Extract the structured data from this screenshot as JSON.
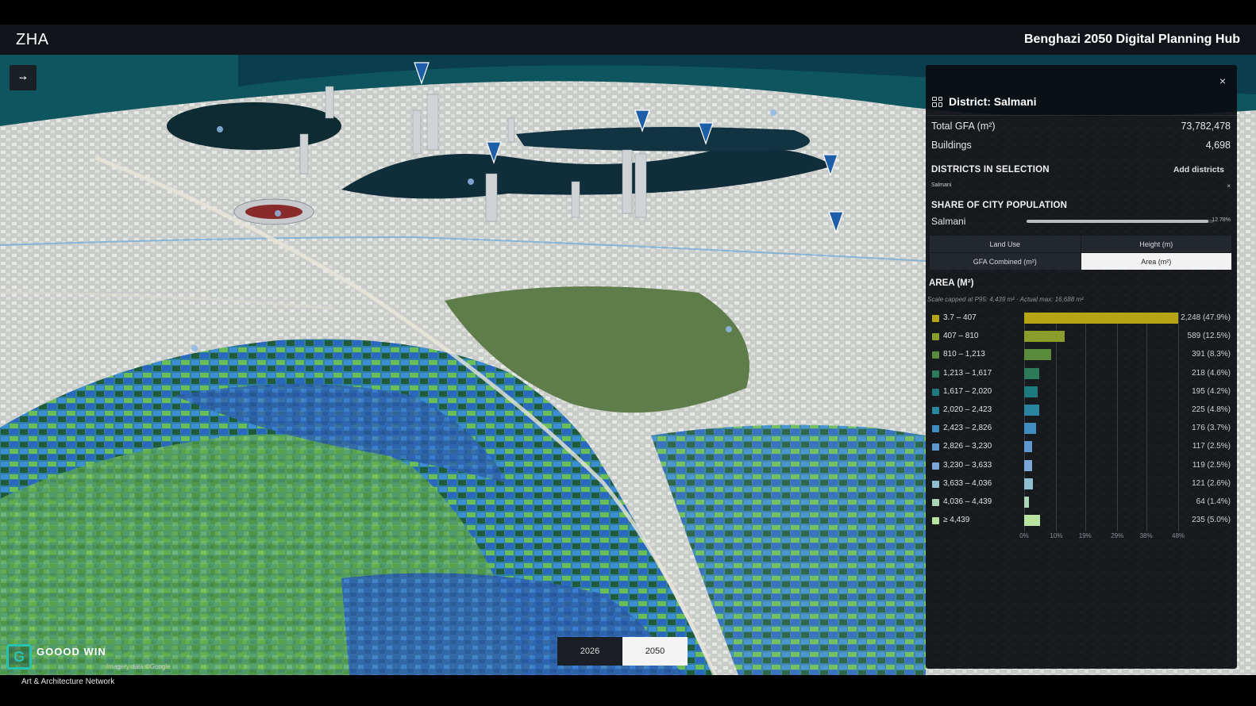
{
  "header": {
    "logo": "ZHA",
    "title": "Benghazi 2050 Digital Planning Hub"
  },
  "map": {
    "nav_icon": "compass-arrow-icon"
  },
  "panel": {
    "title": "District: Salmani",
    "close_label": "×",
    "total_gfa_label": "Total GFA (m²)",
    "total_gfa_value": "73,782,478",
    "buildings_label": "Buildings",
    "buildings_value": "4,698",
    "districts_title": "DISTRICTS IN SELECTION",
    "add_districts_label": "Add districts",
    "selected_district": "Salmani",
    "remove_label": "×",
    "population_title": "SHARE OF CITY POPULATION",
    "population_label": "Salmani",
    "population_share": 12.78,
    "population_value": "12.78%",
    "tabs": [
      {
        "label": "Land Use",
        "active": false
      },
      {
        "label": "Height (m)",
        "active": false
      },
      {
        "label": "GFA Combined (m²)",
        "active": false
      },
      {
        "label": "Area (m²)",
        "active": true
      }
    ],
    "area_title": "AREA (M²)",
    "area_note": "Scale capped at P95: 4,439 m² · Actual max: 16,688 m²"
  },
  "chart_data": {
    "type": "bar",
    "orientation": "horizontal",
    "title": "AREA (M²)",
    "categories": [
      "3.7 – 407",
      "407 – 810",
      "810 – 1,213",
      "1,213 – 1,617",
      "1,617 – 2,020",
      "2,020 – 2,423",
      "2,423 – 2,826",
      "2,826 – 3,230",
      "3,230 – 3,633",
      "3,633 – 4,036",
      "4,036 – 4,439",
      "≥ 4,439"
    ],
    "values": [
      2248,
      589,
      391,
      218,
      195,
      225,
      176,
      117,
      119,
      121,
      64,
      235
    ],
    "percents": [
      47.9,
      12.5,
      8.3,
      4.6,
      4.2,
      4.8,
      3.7,
      2.5,
      2.5,
      2.6,
      1.4,
      5.0
    ],
    "value_labels": [
      "2,248 (47.9%)",
      "589 (12.5%)",
      "391 (8.3%)",
      "218 (4.6%)",
      "195 (4.2%)",
      "225 (4.8%)",
      "176 (3.7%)",
      "117 (2.5%)",
      "119 (2.5%)",
      "121 (2.6%)",
      "64 (1.4%)",
      "235 (5.0%)"
    ],
    "colors": [
      "#b5a515",
      "#8a9d2a",
      "#5b8b3c",
      "#2c7a5a",
      "#1f7a7f",
      "#2a86a0",
      "#3e8cc0",
      "#5f98d0",
      "#7aa7d6",
      "#8fbfcf",
      "#a9d4b6",
      "#b9e2a3"
    ],
    "x_ticks": [
      "0%",
      "10%",
      "19%",
      "29%",
      "38%",
      "48%"
    ],
    "xlim": [
      0,
      48
    ]
  },
  "year_toggle": {
    "options": [
      {
        "label": "2026",
        "active": false
      },
      {
        "label": "2050",
        "active": true
      }
    ]
  },
  "watermark": {
    "brand": "GOOOD WIN",
    "credit": "Imagery data ©Google",
    "subtitle": "Art & Architecture Network"
  }
}
